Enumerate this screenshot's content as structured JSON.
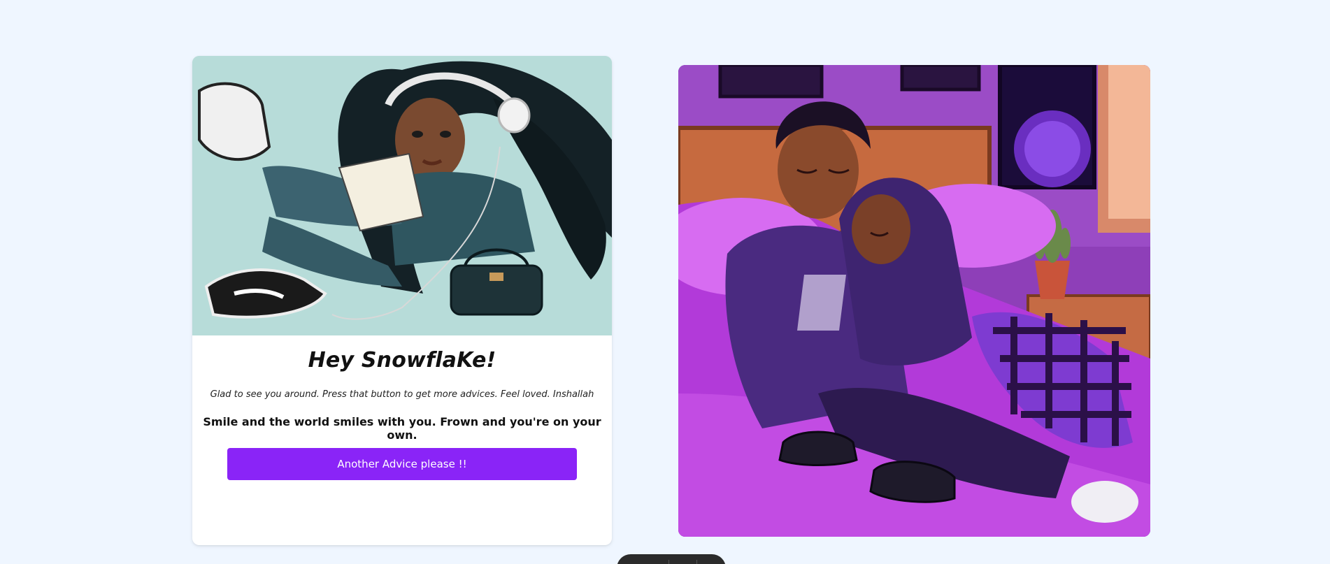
{
  "card": {
    "image_icon": "girl-reading-illustration",
    "title": "Hey SnowflaKe!",
    "subtitle": "Glad to see you around. Press that button to get more advices. Feel loved. Inshallah",
    "advice": "Smile and the world smiles with you. Frown and you're on your own.",
    "button_label": "Another Advice please !!"
  },
  "hero": {
    "image_icon": "couple-sleeping-illustration"
  },
  "colors": {
    "page_background": "#eff6ff",
    "button": "#8a24f7",
    "card": "#ffffff"
  }
}
